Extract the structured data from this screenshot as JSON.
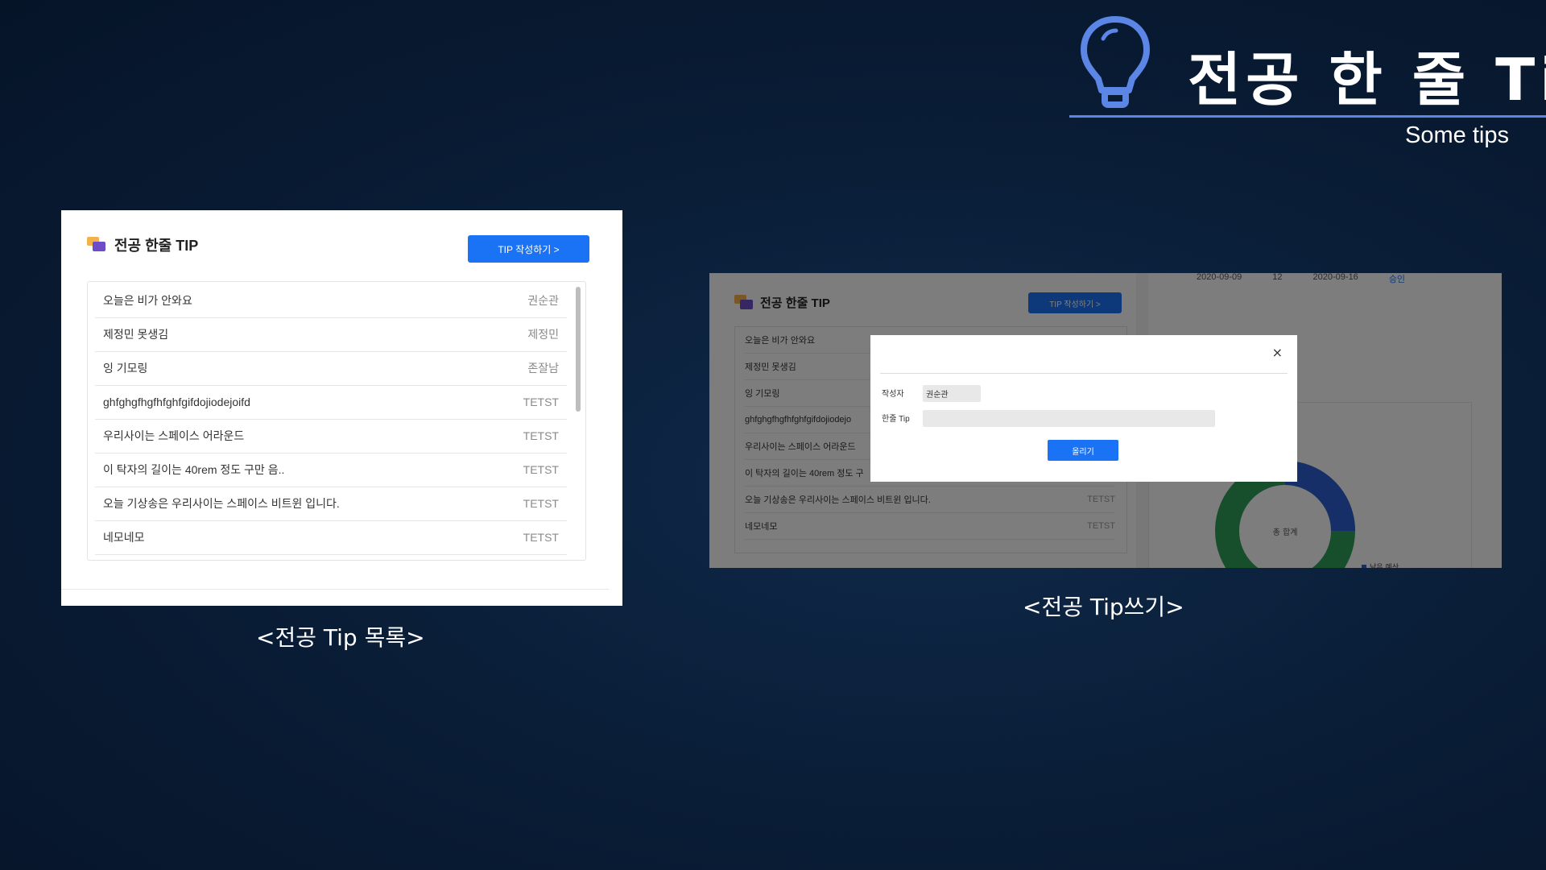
{
  "slide": {
    "title": "전공 한 줄 Tip",
    "subtitle": "Some tips",
    "icon": "lightbulb-icon",
    "accent": "#5b86e5"
  },
  "list_view": {
    "caption": "<전공 Tip 목록>",
    "header_title": "전공 한줄 TIP",
    "write_button": "TIP 작성하기 >",
    "rows": [
      {
        "tip": "오늘은 비가 안와요",
        "author": "권순관"
      },
      {
        "tip": "제정민 못생김",
        "author": "제정민"
      },
      {
        "tip": "잉 기모링",
        "author": "존잘남"
      },
      {
        "tip": "ghfghgfhgfhfghfgifdojiodejoifd",
        "author": "TETST"
      },
      {
        "tip": "우리사이는 스페이스 어라운드",
        "author": "TETST"
      },
      {
        "tip": "이 탁자의 길이는 40rem 정도 구만 음..",
        "author": "TETST"
      },
      {
        "tip": "오늘 기상송은 우리사이는 스페이스 비트윈 입니다.",
        "author": "TETST"
      },
      {
        "tip": "네모네모",
        "author": "TETST"
      }
    ]
  },
  "write_view": {
    "caption": "<전공 Tip쓰기>",
    "header_title": "전공 한줄 TIP",
    "write_button": "TIP 작성하기 >",
    "rows": [
      {
        "tip": "오늘은 비가 안와요",
        "author": ""
      },
      {
        "tip": "제정민 못생김",
        "author": ""
      },
      {
        "tip": "잉 기모링",
        "author": ""
      },
      {
        "tip": "ghfghgfhgfhfghfgifdojiodejo",
        "author": ""
      },
      {
        "tip": "우리사이는 스페이스 어라운드",
        "author": ""
      },
      {
        "tip": "이 탁자의 길이는 40rem 정도 구",
        "author": ""
      },
      {
        "tip": "오늘 기상송은 우리사이는 스페이스 비트윈 입니다.",
        "author": "TETST"
      },
      {
        "tip": "네모네모",
        "author": "TETST"
      }
    ],
    "background_row": {
      "date1": "2020-09-09",
      "count": "12",
      "date2": "2020-09-16",
      "status": "승인"
    },
    "donut_label": "총 합계",
    "legend_label": "남은 예산",
    "modal": {
      "close": "×",
      "author_label": "작성자",
      "author_value": "권순관",
      "tip_label": "한줄 Tip",
      "tip_value": "",
      "submit": "올리기"
    }
  }
}
